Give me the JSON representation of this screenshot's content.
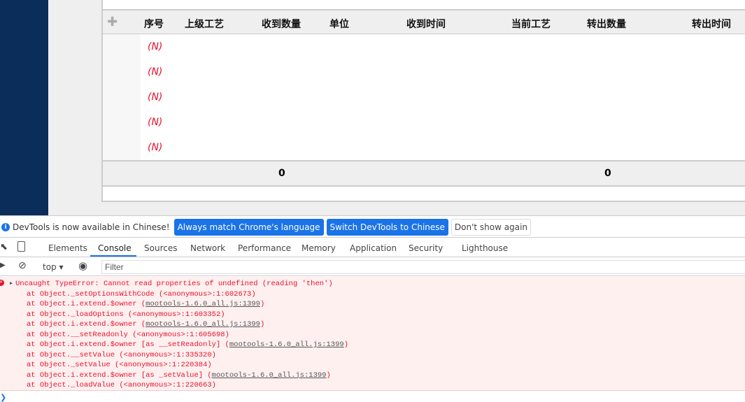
{
  "table": {
    "headers": [
      "序号",
      "上级工艺",
      "收到数量",
      "单位",
      "收到时间",
      "当前工艺",
      "转出数量",
      "转出时间"
    ],
    "rows": [
      "(N)",
      "(N)",
      "(N)",
      "(N)",
      "(N)"
    ],
    "footer": {
      "received_total": "0",
      "out_total": "0"
    }
  },
  "infobar": {
    "message": "DevTools is now available in Chinese!",
    "btn1": "Always match Chrome's language",
    "btn2": "Switch DevTools to Chinese",
    "btn3": "Don't show again"
  },
  "tabs": [
    "Elements",
    "Console",
    "Sources",
    "Network",
    "Performance",
    "Memory",
    "Application",
    "Security",
    "Lighthouse"
  ],
  "toolbar": {
    "context": "top",
    "filter_placeholder": "Filter"
  },
  "console": {
    "error": "Uncaught TypeError: Cannot read properties of undefined (reading 'then')",
    "stack": [
      {
        "text": "at Object._setOptionsWithCode (<anonymous>:1:602673)",
        "link": ""
      },
      {
        "text": "at Object.i.extend.$owner (",
        "link": "mootools-1.6.0_all.js:1399"
      },
      {
        "text": "at Object._loadOptions (<anonymous>:1:603352)",
        "link": ""
      },
      {
        "text": "at Object.i.extend.$owner (",
        "link": "mootools-1.6.0_all.js:1399"
      },
      {
        "text": "at Object.__setReadonly (<anonymous>:1:605698)",
        "link": ""
      },
      {
        "text": "at Object.i.extend.$owner [as __setReadonly] (",
        "link": "mootools-1.6.0_all.js:1399"
      },
      {
        "text": "at Object.__setValue (<anonymous>:1:335320)",
        "link": ""
      },
      {
        "text": "at Object._setValue (<anonymous>:1:220384)",
        "link": ""
      },
      {
        "text": "at Object.i.extend.$owner [as _setValue] (",
        "link": "mootools-1.6.0_all.js:1399"
      },
      {
        "text": "at Object._loadValue (<anonymous>:1:220663)",
        "link": ""
      }
    ]
  }
}
